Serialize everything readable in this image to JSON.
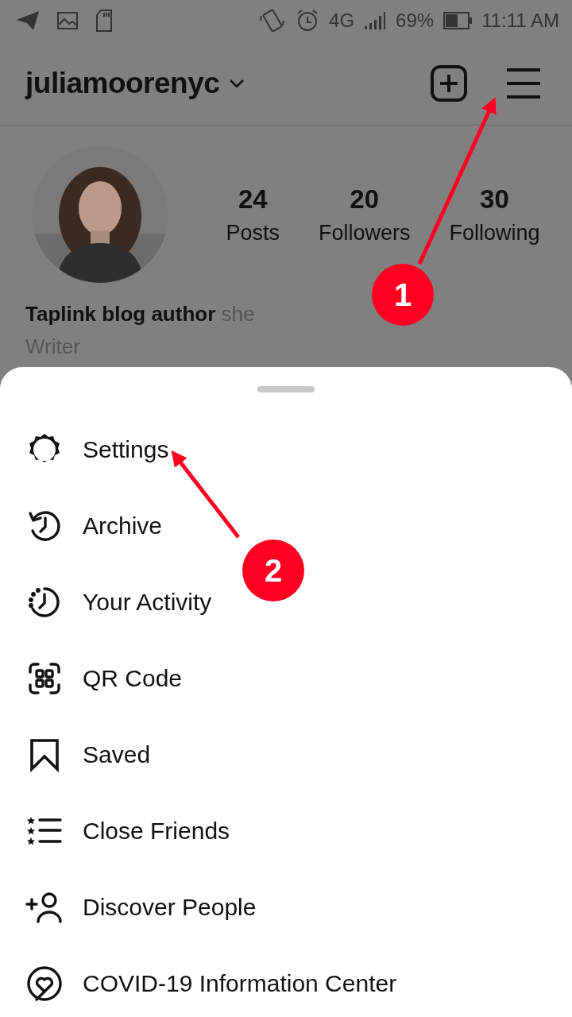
{
  "status_bar": {
    "network": "4G",
    "battery": "69%",
    "time": "11:11 AM"
  },
  "header": {
    "username": "juliamoorenyc"
  },
  "stats": [
    {
      "count": "24",
      "label": "Posts"
    },
    {
      "count": "20",
      "label": "Followers"
    },
    {
      "count": "30",
      "label": "Following"
    }
  ],
  "bio": {
    "name": "Taplink blog author",
    "pronouns": "she",
    "category": "Writer"
  },
  "menu": [
    {
      "label": "Settings"
    },
    {
      "label": "Archive"
    },
    {
      "label": "Your Activity"
    },
    {
      "label": "QR Code"
    },
    {
      "label": "Saved"
    },
    {
      "label": "Close Friends"
    },
    {
      "label": "Discover People"
    },
    {
      "label": "COVID-19 Information Center"
    }
  ],
  "annotations": [
    {
      "label": "1"
    },
    {
      "label": "2"
    }
  ]
}
